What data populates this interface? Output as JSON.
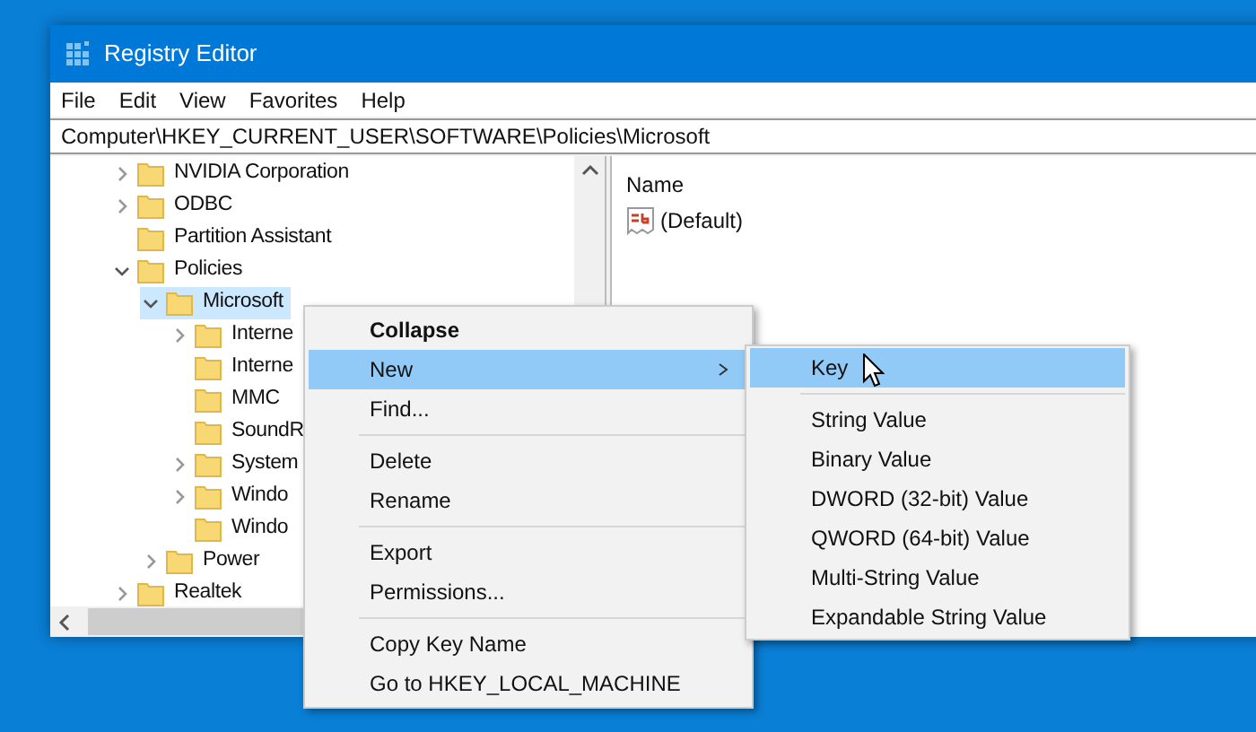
{
  "window": {
    "title": "Registry Editor"
  },
  "menu_bar": [
    "File",
    "Edit",
    "View",
    "Favorites",
    "Help"
  ],
  "address": "Computer\\HKEY_CURRENT_USER\\SOFTWARE\\Policies\\Microsoft",
  "tree": [
    {
      "label": "NVIDIA Corporation",
      "expandable": true,
      "expanded": false,
      "selected": false
    },
    {
      "label": "ODBC",
      "expandable": true,
      "expanded": false,
      "selected": false
    },
    {
      "label": "Partition Assistant",
      "expandable": false,
      "selected": false
    },
    {
      "label": "Policies",
      "expandable": true,
      "expanded": true,
      "selected": false,
      "children": [
        {
          "label": "Microsoft",
          "expandable": true,
          "expanded": true,
          "selected": true,
          "children": [
            {
              "label": "Interne",
              "expandable": true,
              "expanded": false,
              "selected": false
            },
            {
              "label": "Interne",
              "expandable": false,
              "selected": false
            },
            {
              "label": "MMC",
              "expandable": false,
              "selected": false
            },
            {
              "label": "SoundR",
              "expandable": false,
              "selected": false
            },
            {
              "label": "System",
              "expandable": true,
              "expanded": false,
              "selected": false
            },
            {
              "label": "Windo",
              "expandable": true,
              "expanded": false,
              "selected": false
            },
            {
              "label": "Windo",
              "expandable": false,
              "selected": false
            }
          ]
        },
        {
          "label": "Power",
          "expandable": true,
          "expanded": false,
          "selected": false
        }
      ]
    },
    {
      "label": "Realtek",
      "expandable": true,
      "expanded": false,
      "selected": false
    }
  ],
  "values_pane": {
    "columns": [
      "Name"
    ],
    "rows": [
      {
        "name": "(Default)"
      }
    ]
  },
  "context_menu": {
    "items": [
      {
        "kind": "item",
        "label": "Collapse",
        "default": true,
        "submenu": false,
        "selected": false
      },
      {
        "kind": "item",
        "label": "New",
        "default": false,
        "submenu": true,
        "selected": true
      },
      {
        "kind": "item",
        "label": "Find...",
        "default": false,
        "submenu": false,
        "selected": false
      },
      {
        "kind": "separator"
      },
      {
        "kind": "item",
        "label": "Delete",
        "default": false,
        "submenu": false,
        "selected": false
      },
      {
        "kind": "item",
        "label": "Rename",
        "default": false,
        "submenu": false,
        "selected": false
      },
      {
        "kind": "separator"
      },
      {
        "kind": "item",
        "label": "Export",
        "default": false,
        "submenu": false,
        "selected": false
      },
      {
        "kind": "item",
        "label": "Permissions...",
        "default": false,
        "submenu": false,
        "selected": false
      },
      {
        "kind": "separator"
      },
      {
        "kind": "item",
        "label": "Copy Key Name",
        "default": false,
        "submenu": false,
        "selected": false
      },
      {
        "kind": "item",
        "label": "Go to HKEY_LOCAL_MACHINE",
        "default": false,
        "submenu": false,
        "selected": false
      }
    ]
  },
  "submenu": {
    "items": [
      {
        "kind": "item",
        "label": "Key",
        "selected": true
      },
      {
        "kind": "separator"
      },
      {
        "kind": "item",
        "label": "String Value",
        "selected": false
      },
      {
        "kind": "item",
        "label": "Binary Value",
        "selected": false
      },
      {
        "kind": "item",
        "label": "DWORD (32-bit) Value",
        "selected": false
      },
      {
        "kind": "item",
        "label": "QWORD (64-bit) Value",
        "selected": false
      },
      {
        "kind": "item",
        "label": "Multi-String Value",
        "selected": false
      },
      {
        "kind": "item",
        "label": "Expandable String Value",
        "selected": false
      }
    ]
  }
}
